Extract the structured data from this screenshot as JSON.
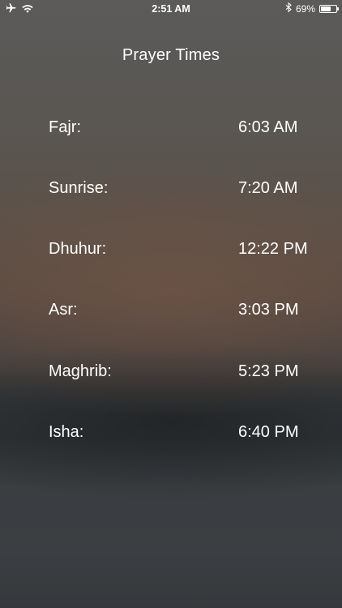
{
  "status_bar": {
    "time": "2:51 AM",
    "battery_percent": "69%",
    "battery_level": 0.69,
    "icons": [
      "airplane-icon",
      "wifi-icon",
      "bluetooth-icon",
      "battery-icon"
    ]
  },
  "page": {
    "title": "Prayer Times"
  },
  "prayers": [
    {
      "name": "Fajr:",
      "time": "6:03 AM"
    },
    {
      "name": "Sunrise:",
      "time": "7:20 AM"
    },
    {
      "name": "Dhuhur:",
      "time": "12:22 PM"
    },
    {
      "name": "Asr:",
      "time": "3:03 PM"
    },
    {
      "name": "Maghrib:",
      "time": "5:23 PM"
    },
    {
      "name": "Isha:",
      "time": "6:40 PM"
    }
  ],
  "colors": {
    "text": "#ffffff"
  }
}
